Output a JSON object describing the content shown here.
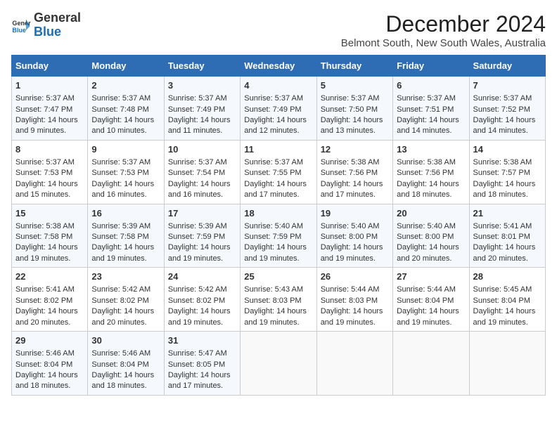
{
  "header": {
    "logo_line1": "General",
    "logo_line2": "Blue",
    "month_year": "December 2024",
    "location": "Belmont South, New South Wales, Australia"
  },
  "days_of_week": [
    "Sunday",
    "Monday",
    "Tuesday",
    "Wednesday",
    "Thursday",
    "Friday",
    "Saturday"
  ],
  "weeks": [
    [
      {
        "day": "1",
        "sunrise": "5:37 AM",
        "sunset": "7:47 PM",
        "daylight": "14 hours and 9 minutes."
      },
      {
        "day": "2",
        "sunrise": "5:37 AM",
        "sunset": "7:48 PM",
        "daylight": "14 hours and 10 minutes."
      },
      {
        "day": "3",
        "sunrise": "5:37 AM",
        "sunset": "7:49 PM",
        "daylight": "14 hours and 11 minutes."
      },
      {
        "day": "4",
        "sunrise": "5:37 AM",
        "sunset": "7:49 PM",
        "daylight": "14 hours and 12 minutes."
      },
      {
        "day": "5",
        "sunrise": "5:37 AM",
        "sunset": "7:50 PM",
        "daylight": "14 hours and 13 minutes."
      },
      {
        "day": "6",
        "sunrise": "5:37 AM",
        "sunset": "7:51 PM",
        "daylight": "14 hours and 14 minutes."
      },
      {
        "day": "7",
        "sunrise": "5:37 AM",
        "sunset": "7:52 PM",
        "daylight": "14 hours and 14 minutes."
      }
    ],
    [
      {
        "day": "8",
        "sunrise": "5:37 AM",
        "sunset": "7:53 PM",
        "daylight": "14 hours and 15 minutes."
      },
      {
        "day": "9",
        "sunrise": "5:37 AM",
        "sunset": "7:53 PM",
        "daylight": "14 hours and 16 minutes."
      },
      {
        "day": "10",
        "sunrise": "5:37 AM",
        "sunset": "7:54 PM",
        "daylight": "14 hours and 16 minutes."
      },
      {
        "day": "11",
        "sunrise": "5:37 AM",
        "sunset": "7:55 PM",
        "daylight": "14 hours and 17 minutes."
      },
      {
        "day": "12",
        "sunrise": "5:38 AM",
        "sunset": "7:56 PM",
        "daylight": "14 hours and 17 minutes."
      },
      {
        "day": "13",
        "sunrise": "5:38 AM",
        "sunset": "7:56 PM",
        "daylight": "14 hours and 18 minutes."
      },
      {
        "day": "14",
        "sunrise": "5:38 AM",
        "sunset": "7:57 PM",
        "daylight": "14 hours and 18 minutes."
      }
    ],
    [
      {
        "day": "15",
        "sunrise": "5:38 AM",
        "sunset": "7:58 PM",
        "daylight": "14 hours and 19 minutes."
      },
      {
        "day": "16",
        "sunrise": "5:39 AM",
        "sunset": "7:58 PM",
        "daylight": "14 hours and 19 minutes."
      },
      {
        "day": "17",
        "sunrise": "5:39 AM",
        "sunset": "7:59 PM",
        "daylight": "14 hours and 19 minutes."
      },
      {
        "day": "18",
        "sunrise": "5:40 AM",
        "sunset": "7:59 PM",
        "daylight": "14 hours and 19 minutes."
      },
      {
        "day": "19",
        "sunrise": "5:40 AM",
        "sunset": "8:00 PM",
        "daylight": "14 hours and 19 minutes."
      },
      {
        "day": "20",
        "sunrise": "5:40 AM",
        "sunset": "8:00 PM",
        "daylight": "14 hours and 20 minutes."
      },
      {
        "day": "21",
        "sunrise": "5:41 AM",
        "sunset": "8:01 PM",
        "daylight": "14 hours and 20 minutes."
      }
    ],
    [
      {
        "day": "22",
        "sunrise": "5:41 AM",
        "sunset": "8:02 PM",
        "daylight": "14 hours and 20 minutes."
      },
      {
        "day": "23",
        "sunrise": "5:42 AM",
        "sunset": "8:02 PM",
        "daylight": "14 hours and 20 minutes."
      },
      {
        "day": "24",
        "sunrise": "5:42 AM",
        "sunset": "8:02 PM",
        "daylight": "14 hours and 19 minutes."
      },
      {
        "day": "25",
        "sunrise": "5:43 AM",
        "sunset": "8:03 PM",
        "daylight": "14 hours and 19 minutes."
      },
      {
        "day": "26",
        "sunrise": "5:44 AM",
        "sunset": "8:03 PM",
        "daylight": "14 hours and 19 minutes."
      },
      {
        "day": "27",
        "sunrise": "5:44 AM",
        "sunset": "8:04 PM",
        "daylight": "14 hours and 19 minutes."
      },
      {
        "day": "28",
        "sunrise": "5:45 AM",
        "sunset": "8:04 PM",
        "daylight": "14 hours and 19 minutes."
      }
    ],
    [
      {
        "day": "29",
        "sunrise": "5:46 AM",
        "sunset": "8:04 PM",
        "daylight": "14 hours and 18 minutes."
      },
      {
        "day": "30",
        "sunrise": "5:46 AM",
        "sunset": "8:04 PM",
        "daylight": "14 hours and 18 minutes."
      },
      {
        "day": "31",
        "sunrise": "5:47 AM",
        "sunset": "8:05 PM",
        "daylight": "14 hours and 17 minutes."
      },
      null,
      null,
      null,
      null
    ]
  ]
}
